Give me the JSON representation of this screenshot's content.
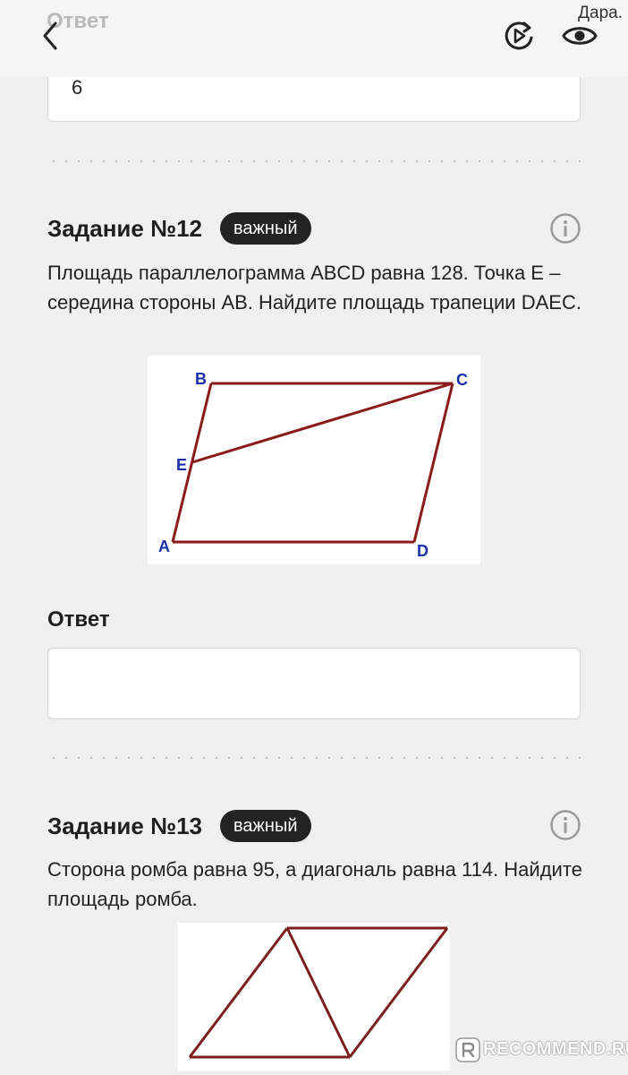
{
  "header": {
    "prev_answer_label": "Ответ",
    "watermark_text": "Дара."
  },
  "prev_answer": {
    "value": "6"
  },
  "task12": {
    "title": "Задание №12",
    "badge": "важный",
    "text": "Площадь параллелограмма ABCD равна 128. Точка E – середина стороны AB. Найдите площадь трапеции DAEC.",
    "figure_labels": {
      "a": "A",
      "b": "B",
      "c": "C",
      "d": "D",
      "e": "E"
    },
    "answer_label": "Ответ",
    "answer_value": ""
  },
  "task13": {
    "title": "Задание №13",
    "badge": "важный",
    "text": "Сторона ромба равна 95, а диагональ равна 114. Найдите площадь ромба."
  },
  "footer": {
    "watermark": "RECOMMEND.RU"
  },
  "colors": {
    "figure_stroke": "#8b1a1a",
    "label_blue": "#1a2fa8",
    "badge_bg": "#232323"
  }
}
